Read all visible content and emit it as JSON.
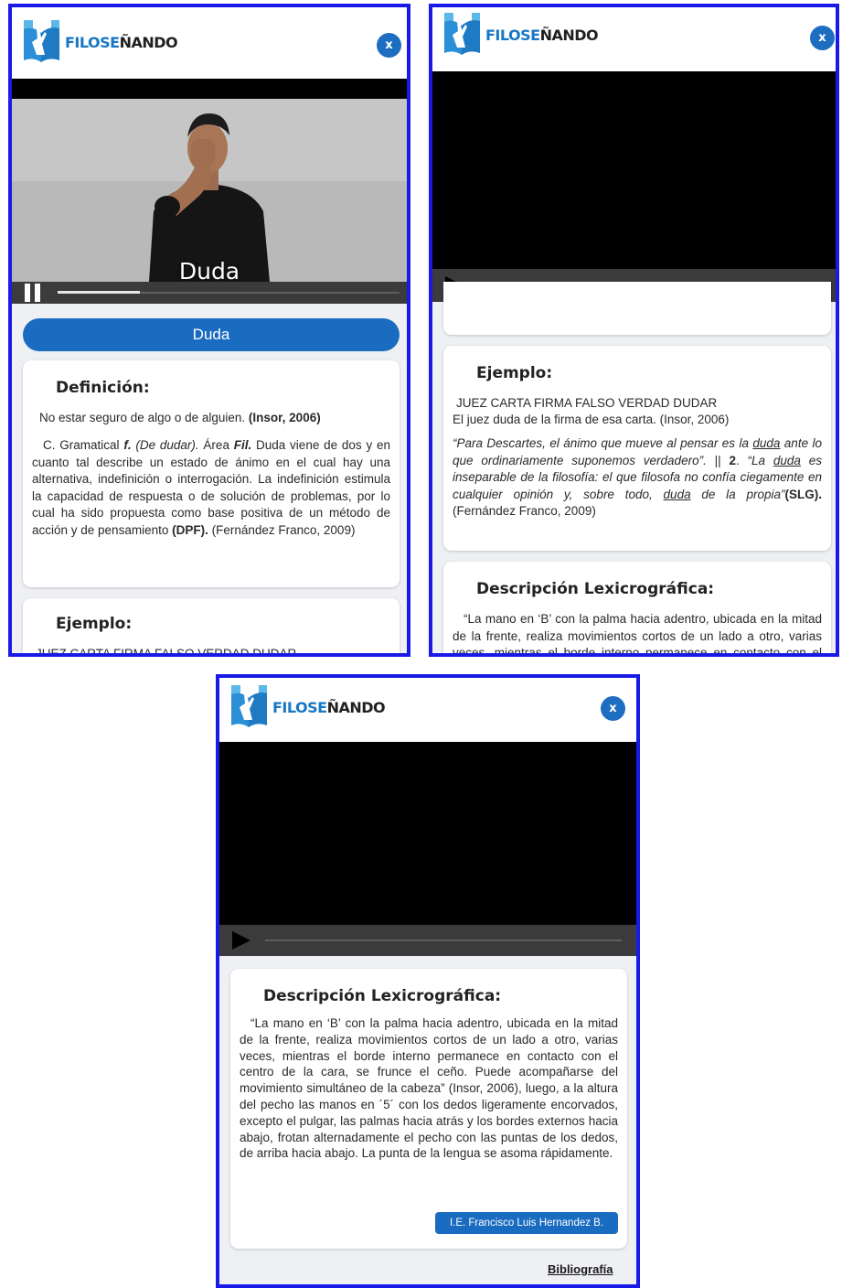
{
  "brand": {
    "part1": "FILOSE",
    "part2": "ÑANDO"
  },
  "close_label": "x",
  "video": {
    "caption": "Duda",
    "progress": 0.24
  },
  "word_button": "Duda",
  "definition": {
    "heading": "Definición:",
    "p1_text": "No estar seguro de algo o de alguien. ",
    "p1_cite": "(Insor, 2006)",
    "p2": {
      "a": "C. Gramatical ",
      "b": "f.",
      "c": " (De dudar).",
      "d": " Área ",
      "e": "Fil.",
      "f": " Duda viene de dos y en cuanto tal describe un estado de ánimo en el cual hay una alternativa, indefinición o interrogación. La indefinición estimula la capacidad de respuesta o de solución de problemas, por lo cual ha sido propuesta como base positiva de un método de acción y de pensamiento ",
      "g": "(DPF).",
      "h": " (Fernández Franco, 2009)"
    }
  },
  "example": {
    "heading": "Ejemplo:",
    "gloss": "JUEZ CARTA FIRMA FALSO VERDAD DUDAR",
    "sentence": "El juez duda de la firma de esa carta. (Insor, 2006)",
    "quote": {
      "a": "“Para Descartes, el ánimo que mueve al pensar es la ",
      "b": "duda",
      "c": " ante lo que ordinariamente suponemos verdadero”.",
      "d": " || ",
      "e": "2",
      "f": ". ",
      "g": "“La ",
      "h": "duda",
      "i": " es inseparable de la filosofía: el que filosofa no confía ciegamente en cualquier opinión y, sobre todo, ",
      "j": "duda",
      "k": " de la propia”",
      "l": "(SLG).",
      "m": " (Fernández Franco, 2009)"
    }
  },
  "lexico": {
    "heading": "Descripción Lexicrográfica:",
    "text": "“La mano en ‘B’ con la palma hacia adentro, ubicada en la mitad de la frente, realiza movimientos cortos de un lado a otro, varias veces, mientras el borde interno permanece en contacto con el centro de la cara, se frunce el ceño. Puede acompañarse del movimiento simultáneo de la cabeza” (Insor, 2006), luego, a la altura del pecho las manos en ´5´ con los dedos ligeramente encorvados, excepto  el pulgar, las palmas hacia atrás y los bordes externos hacia abajo, frotan alternadamente el pecho con las puntas de los dedos, de arriba hacia abajo.  La punta de la lengua se asoma rápidamente.",
    "author": "I.E. Francisco Luis Hernandez B."
  },
  "bibliography": "Bibliografía"
}
